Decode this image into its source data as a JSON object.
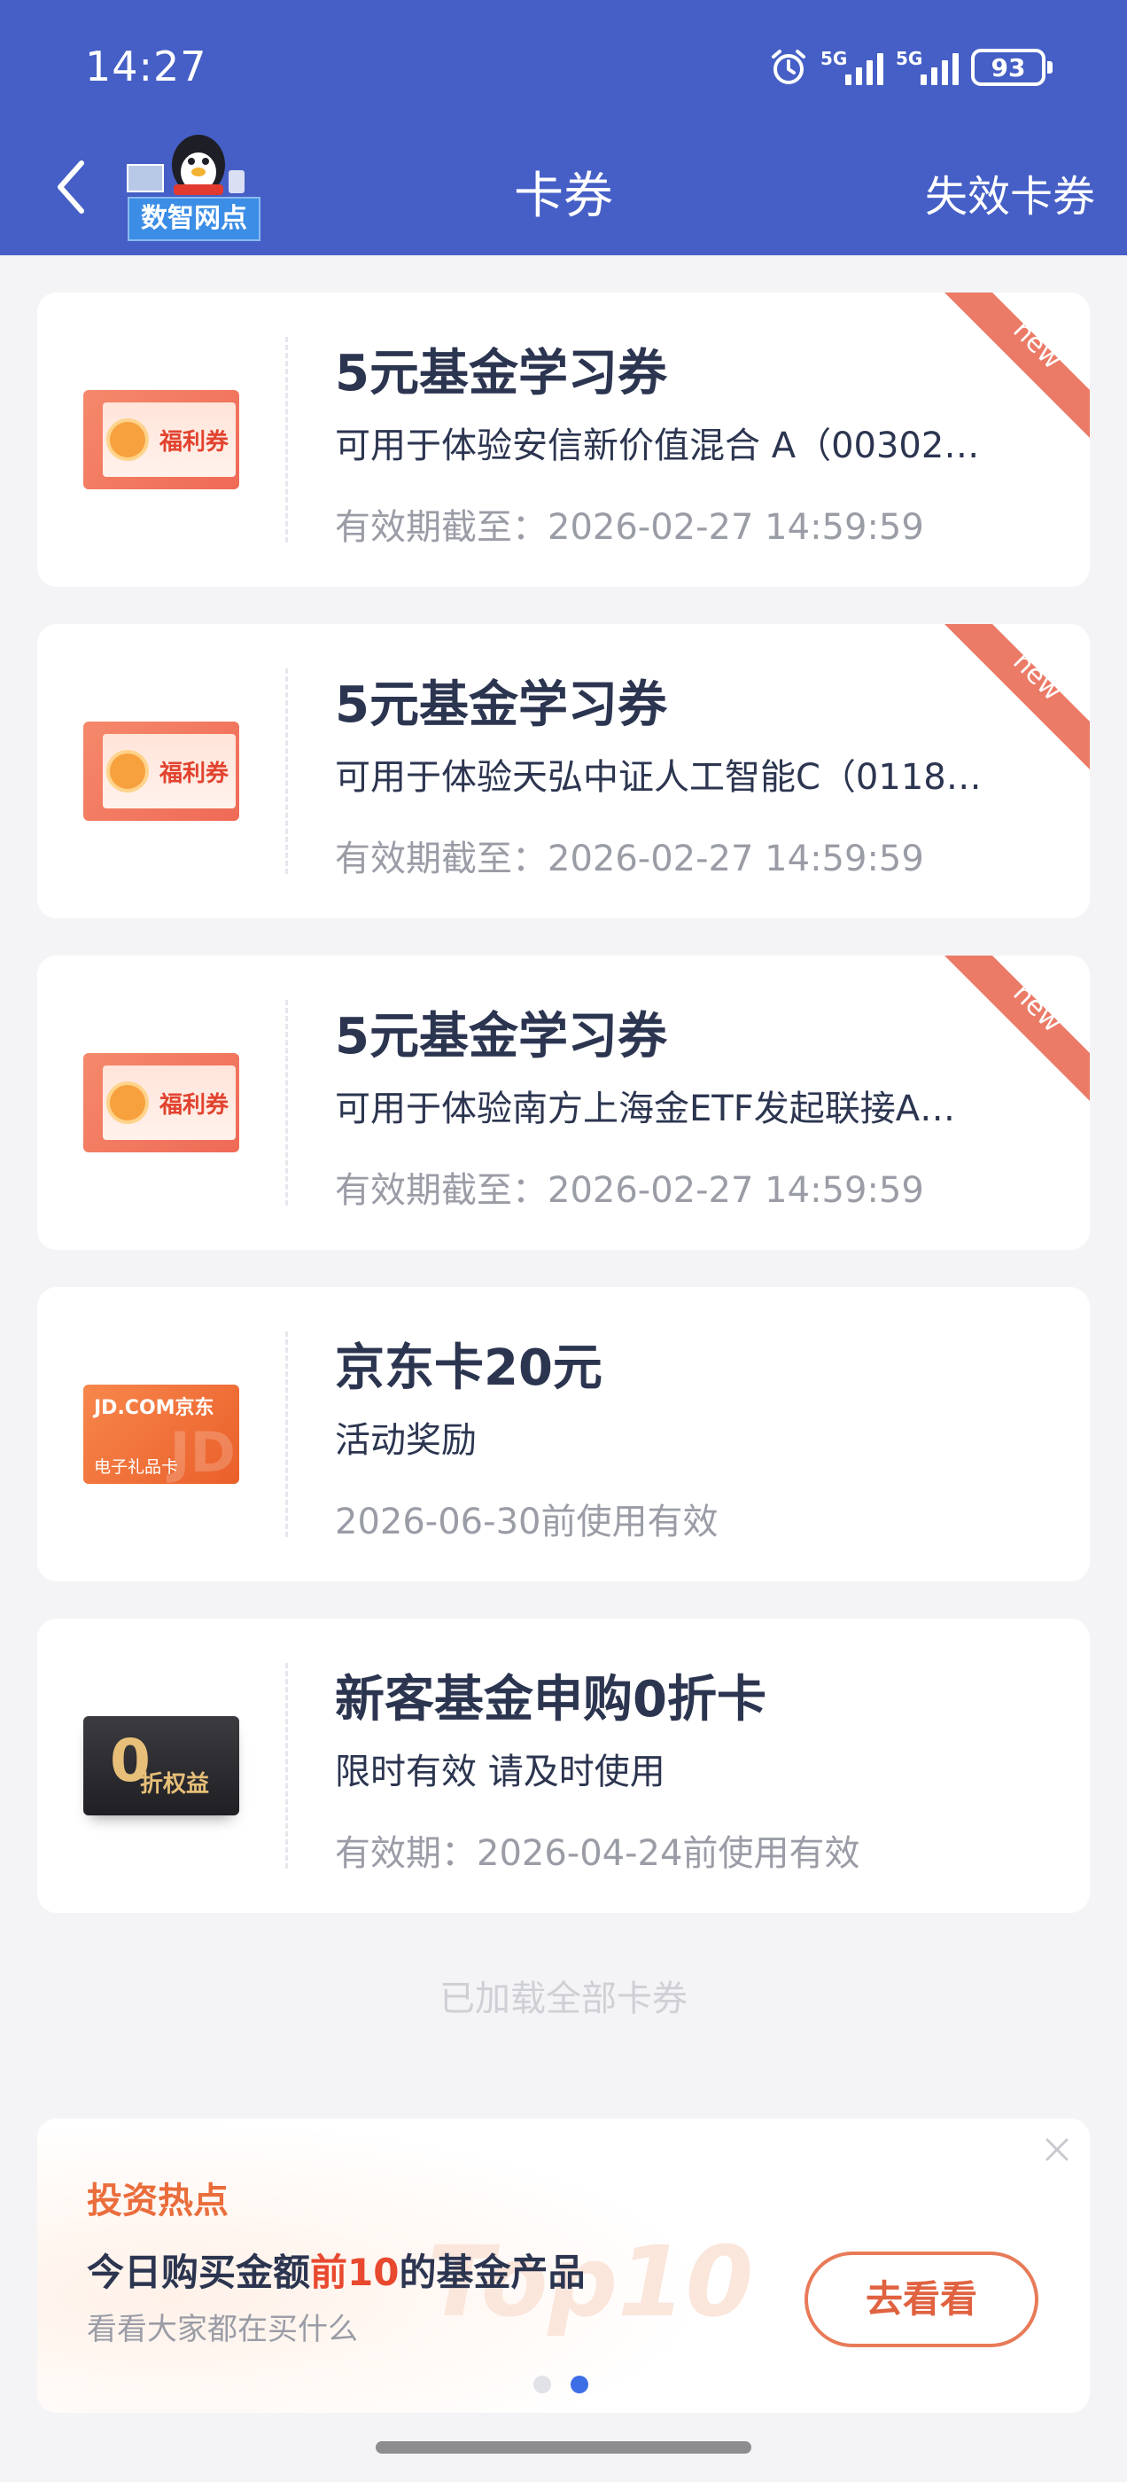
{
  "status_bar": {
    "time": "14:27",
    "network_1": "5G",
    "network_2": "5G",
    "battery": "93"
  },
  "header": {
    "title": "卡券",
    "mascot_label": "数智网点",
    "expired_link": "失效卡券"
  },
  "coupons": [
    {
      "title": "5元基金学习券",
      "desc": "可用于体验安信新价值混合 A（00302…",
      "date": "有效期截至：2026-02-27 14:59:59",
      "thumb_label": "福利券",
      "ribbon": "new"
    },
    {
      "title": "5元基金学习券",
      "desc": "可用于体验天弘中证人工智能C（0118…",
      "date": "有效期截至：2026-02-27 14:59:59",
      "thumb_label": "福利券",
      "ribbon": "new"
    },
    {
      "title": "5元基金学习券",
      "desc": "可用于体验南方上海金ETF发起联接A…",
      "date": "有效期截至：2026-02-27 14:59:59",
      "thumb_label": "福利券",
      "ribbon": "new"
    },
    {
      "title": "京东卡20元",
      "desc": "活动奖励",
      "date": "2026-06-30前使用有效",
      "thumb_brand": "JD.COM京东",
      "thumb_sub": "电子礼品卡",
      "thumb_wm": "JD"
    },
    {
      "title": "新客基金申购0折卡",
      "desc": "限时有效 请及时使用",
      "date": "有效期：2026-04-24前使用有效",
      "thumb_big": "0",
      "thumb_text": "折权益"
    }
  ],
  "load_all_text": "已加载全部卡券",
  "promo": {
    "tag": "投资热点",
    "headline_pre": "今日购买金额",
    "headline_highlight": "前10",
    "headline_post": "的基金产品",
    "sub": "看看大家都在买什么",
    "watermark": "Top10",
    "button": "去看看",
    "highlight_color": "#e8492f"
  },
  "colors": {
    "header_bg": "#455fc6",
    "ribbon": "#eb7a66",
    "accent": "#e87a58"
  }
}
